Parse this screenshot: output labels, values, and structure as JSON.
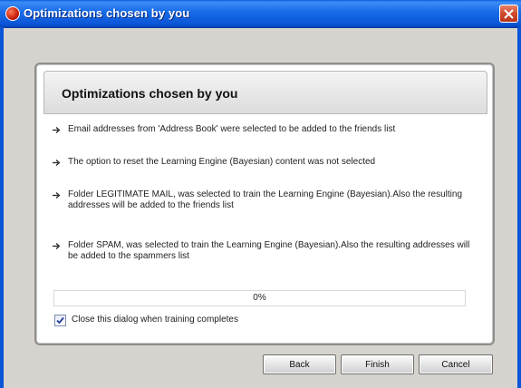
{
  "window": {
    "title": "Optimizations chosen by you"
  },
  "panel": {
    "title": "Optimizations chosen by you",
    "items": [
      "Email addresses from 'Address Book' were selected to be added to the friends list",
      "The option to reset the Learning Engine (Bayesian) content was not selected",
      "Folder LEGITIMATE MAIL, was selected to train the Learning Engine (Bayesian).Also the resulting addresses will be added to the friends list",
      "Folder SPAM, was selected to train the Learning Engine (Bayesian).Also the resulting addresses will be added to the spammers list"
    ]
  },
  "progress": {
    "value": 0,
    "label": "0%"
  },
  "close_when_done": {
    "checked": true,
    "label": "Close this dialog when training completes"
  },
  "buttons": {
    "back": "Back",
    "finish": "Finish",
    "cancel": "Cancel"
  },
  "icons": {
    "app": "app-icon",
    "close": "close-icon",
    "bullet": "arrow-right-icon",
    "check": "check-icon"
  },
  "colors": {
    "titlebar": "#0b56d8",
    "close_button": "#cf4a2a",
    "background": "#d6d3ce"
  }
}
